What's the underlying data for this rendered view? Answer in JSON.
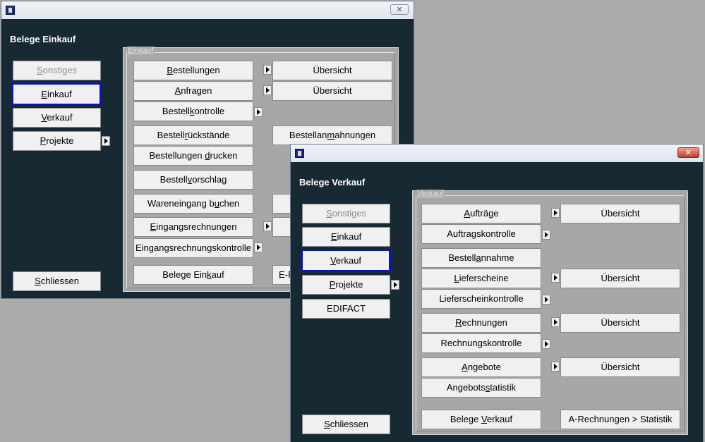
{
  "einkauf_window": {
    "heading": "Belege Einkauf",
    "close_glyph": "✕",
    "group_label": "Einkauf",
    "sonstiges": [
      "",
      "S",
      "onstiges"
    ],
    "einkauf": [
      "",
      "E",
      "inkauf"
    ],
    "verkauf": [
      "",
      "V",
      "erkauf"
    ],
    "projekte": [
      "",
      "P",
      "rojekte"
    ],
    "schliessen": [
      "",
      "S",
      "chliessen"
    ],
    "bestellungen": [
      "",
      "B",
      "estellungen"
    ],
    "bestellungen_uebersicht": "Übersicht",
    "anfragen": [
      "",
      "A",
      "nfragen"
    ],
    "anfragen_uebersicht": "Übersicht",
    "bestellkontrolle": [
      "Bestell",
      "k",
      "ontrolle"
    ],
    "bestellrueckstaende": [
      "Bestell",
      "r",
      "ückstände"
    ],
    "bestellanmahnungen": [
      "Bestellan",
      "m",
      "ahnungen"
    ],
    "bestellungen_drucken": [
      "Bestellungen ",
      "d",
      "rucken"
    ],
    "bestellvorschlag": [
      "Bestell",
      "v",
      "orschlag"
    ],
    "wareneingang_buchen": [
      "Wareneingang b",
      "u",
      "chen"
    ],
    "eingangsrechnungen": [
      "",
      "E",
      "ingangsrechnungen"
    ],
    "eingangsrechnungskontrolle": [
      "Eingangsrechnungskontrolle",
      "",
      ""
    ],
    "belege_einkauf": [
      "Belege Ein",
      "k",
      "auf"
    ],
    "e_partial": "E-R"
  },
  "verkauf_window": {
    "heading": "Belege Verkauf",
    "close_glyph": "✕",
    "group_label": "Verkauf",
    "sonstiges": [
      "",
      "S",
      "onstiges"
    ],
    "einkauf": [
      "",
      "E",
      "inkauf"
    ],
    "verkauf": [
      "",
      "V",
      "erkauf"
    ],
    "projekte": [
      "",
      "P",
      "rojekte"
    ],
    "edifact": "EDIFACT",
    "schliessen": [
      "",
      "S",
      "chliessen"
    ],
    "auftraege": [
      "",
      "A",
      "ufträge"
    ],
    "auftraege_uebersicht": "Übersicht",
    "auftragskontrolle": [
      "Auftragskontrolle",
      "",
      ""
    ],
    "bestellannahme": [
      "Bestell",
      "a",
      "nnahme"
    ],
    "lieferscheine": [
      "",
      "L",
      "ieferscheine"
    ],
    "lieferscheine_uebersicht": "Übersicht",
    "lieferscheinkontrolle": [
      "Lieferscheinkontrolle",
      "",
      ""
    ],
    "rechnungen": [
      "",
      "R",
      "echnungen"
    ],
    "rechnungen_uebersicht": "Übersicht",
    "rechnungskontrolle": [
      "Rechnungskontrolle",
      "",
      ""
    ],
    "angebote": [
      "",
      "A",
      "ngebote"
    ],
    "angebote_uebersicht": "Übersicht",
    "angebotsstatistik": [
      "Angebots",
      "s",
      "tatistik"
    ],
    "belege_verkauf": [
      "Belege ",
      "V",
      "erkauf"
    ],
    "a_rechnungen_statistik": "A-Rechnungen > Statistik"
  }
}
